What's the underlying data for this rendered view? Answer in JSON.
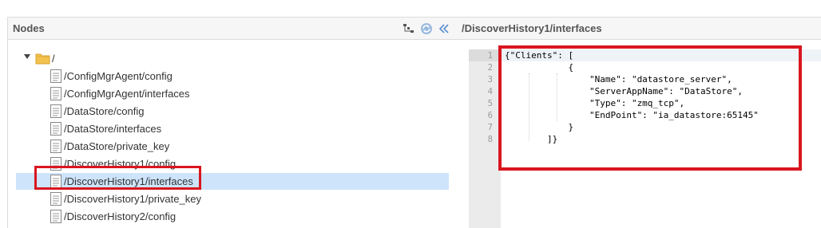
{
  "left_panel": {
    "title": "Nodes",
    "icons": [
      "tree-expand-icon",
      "refresh-icon",
      "collapse-panel-icon"
    ],
    "root": {
      "label": "/",
      "icon": "folder-icon"
    },
    "nodes": [
      {
        "label": "/ConfigMgrAgent/config"
      },
      {
        "label": "/ConfigMgrAgent/interfaces"
      },
      {
        "label": "/DataStore/config"
      },
      {
        "label": "/DataStore/interfaces"
      },
      {
        "label": "/DataStore/private_key"
      },
      {
        "label": "/DiscoverHistory1/config"
      },
      {
        "label": "/DiscoverHistory1/interfaces",
        "selected": true
      },
      {
        "label": "/DiscoverHistory1/private_key"
      },
      {
        "label": "/DiscoverHistory2/config"
      }
    ]
  },
  "right_panel": {
    "title": "/DiscoverHistory1/interfaces",
    "line_numbers": [
      "1",
      "2",
      "3",
      "4",
      "5",
      "6",
      "7",
      "8"
    ],
    "code_lines": [
      "{\"Clients\": [",
      "            {",
      "                \"Name\": \"datastore_server\",",
      "                \"ServerAppName\": \"DataStore\",",
      "                \"Type\": \"zmq_tcp\",",
      "                \"EndPoint\": \"ia_datastore:65145\"",
      "            }",
      "        ]}"
    ]
  },
  "colors": {
    "highlight": "#d9161f",
    "selection": "#cde4fb",
    "header_bg": "#f6f6f6",
    "gutter_bg": "#ebebeb"
  }
}
